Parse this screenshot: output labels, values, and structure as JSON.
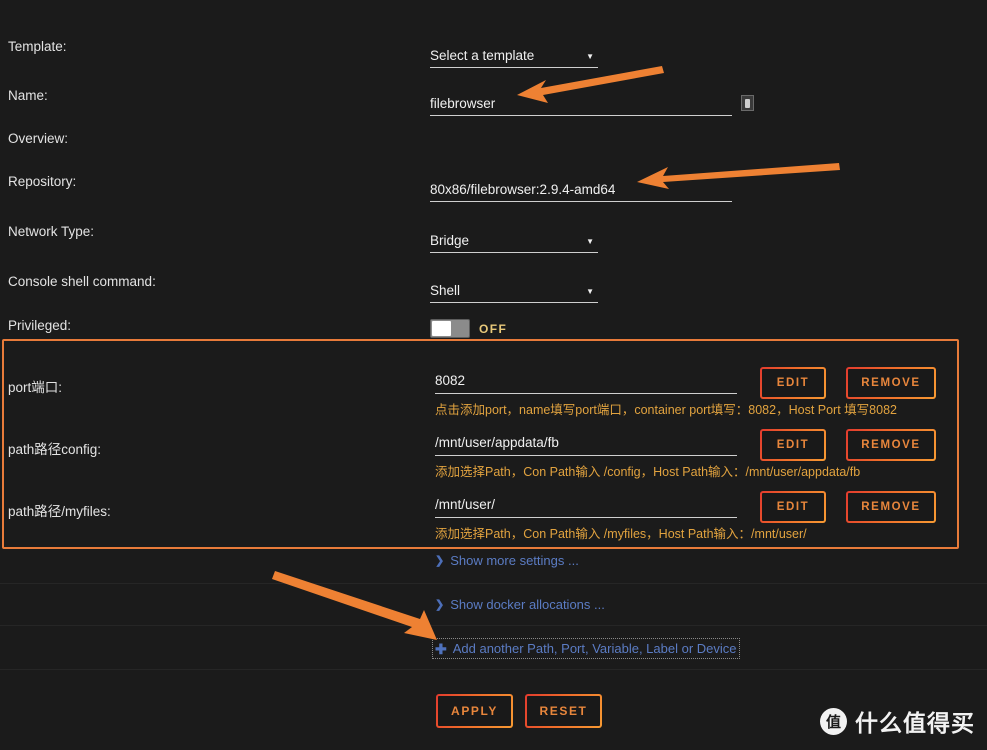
{
  "theme": {
    "background": "#1b1b1b",
    "text": "#dcdcdc",
    "accent_orange": "#e87b3a",
    "hint_orange": "#e2a33f",
    "link_blue": "#5b7cc4",
    "button_text": "#e8863c"
  },
  "form": {
    "template": {
      "label": "Template:",
      "value": "Select a template",
      "caret": "chevron-down-icon"
    },
    "name": {
      "label": "Name:",
      "value": "filebrowser",
      "placeholder": "",
      "icon": "info-box-icon"
    },
    "overview": {
      "label": "Overview:"
    },
    "repository": {
      "label": "Repository:",
      "value": "80x86/filebrowser:2.9.4-amd64",
      "placeholder": ""
    },
    "network_type": {
      "label": "Network Type:",
      "value": "Bridge"
    },
    "console_shell": {
      "label": "Console shell command:",
      "value": "Shell"
    },
    "privileged": {
      "label": "Privileged:",
      "state": "OFF"
    }
  },
  "mappings": [
    {
      "label": "port端口:",
      "value": "8082",
      "hint": "点击添加port，name填写port端口，container port填写：8082，Host Port 填写8082",
      "edit_label": "EDIT",
      "remove_label": "REMOVE"
    },
    {
      "label": "path路径config:",
      "value": "/mnt/user/appdata/fb",
      "hint": "添加选择Path，Con Path输入 /config，Host Path输入：/mnt/user/appdata/fb",
      "edit_label": "EDIT",
      "remove_label": "REMOVE"
    },
    {
      "label": "path路径/myfiles:",
      "value": "/mnt/user/",
      "hint": "添加选择Path，Con Path输入 /myfiles，Host Path输入：/mnt/user/",
      "edit_label": "EDIT",
      "remove_label": "REMOVE"
    }
  ],
  "links": {
    "show_more_settings": "Show more settings ...",
    "show_docker_allocations": "Show docker allocations ...",
    "add_another": "Add another Path, Port, Variable, Label or Device"
  },
  "actions": {
    "apply": "APPLY",
    "reset": "RESET"
  },
  "annotations": [
    {
      "name": "arrow-to-name-field",
      "color": "#ee8133"
    },
    {
      "name": "arrow-to-repository-field",
      "color": "#ee8133"
    },
    {
      "name": "arrow-to-add-another-link",
      "color": "#ee8133"
    }
  ],
  "watermark": {
    "badge": "值",
    "text": "什么值得买"
  }
}
